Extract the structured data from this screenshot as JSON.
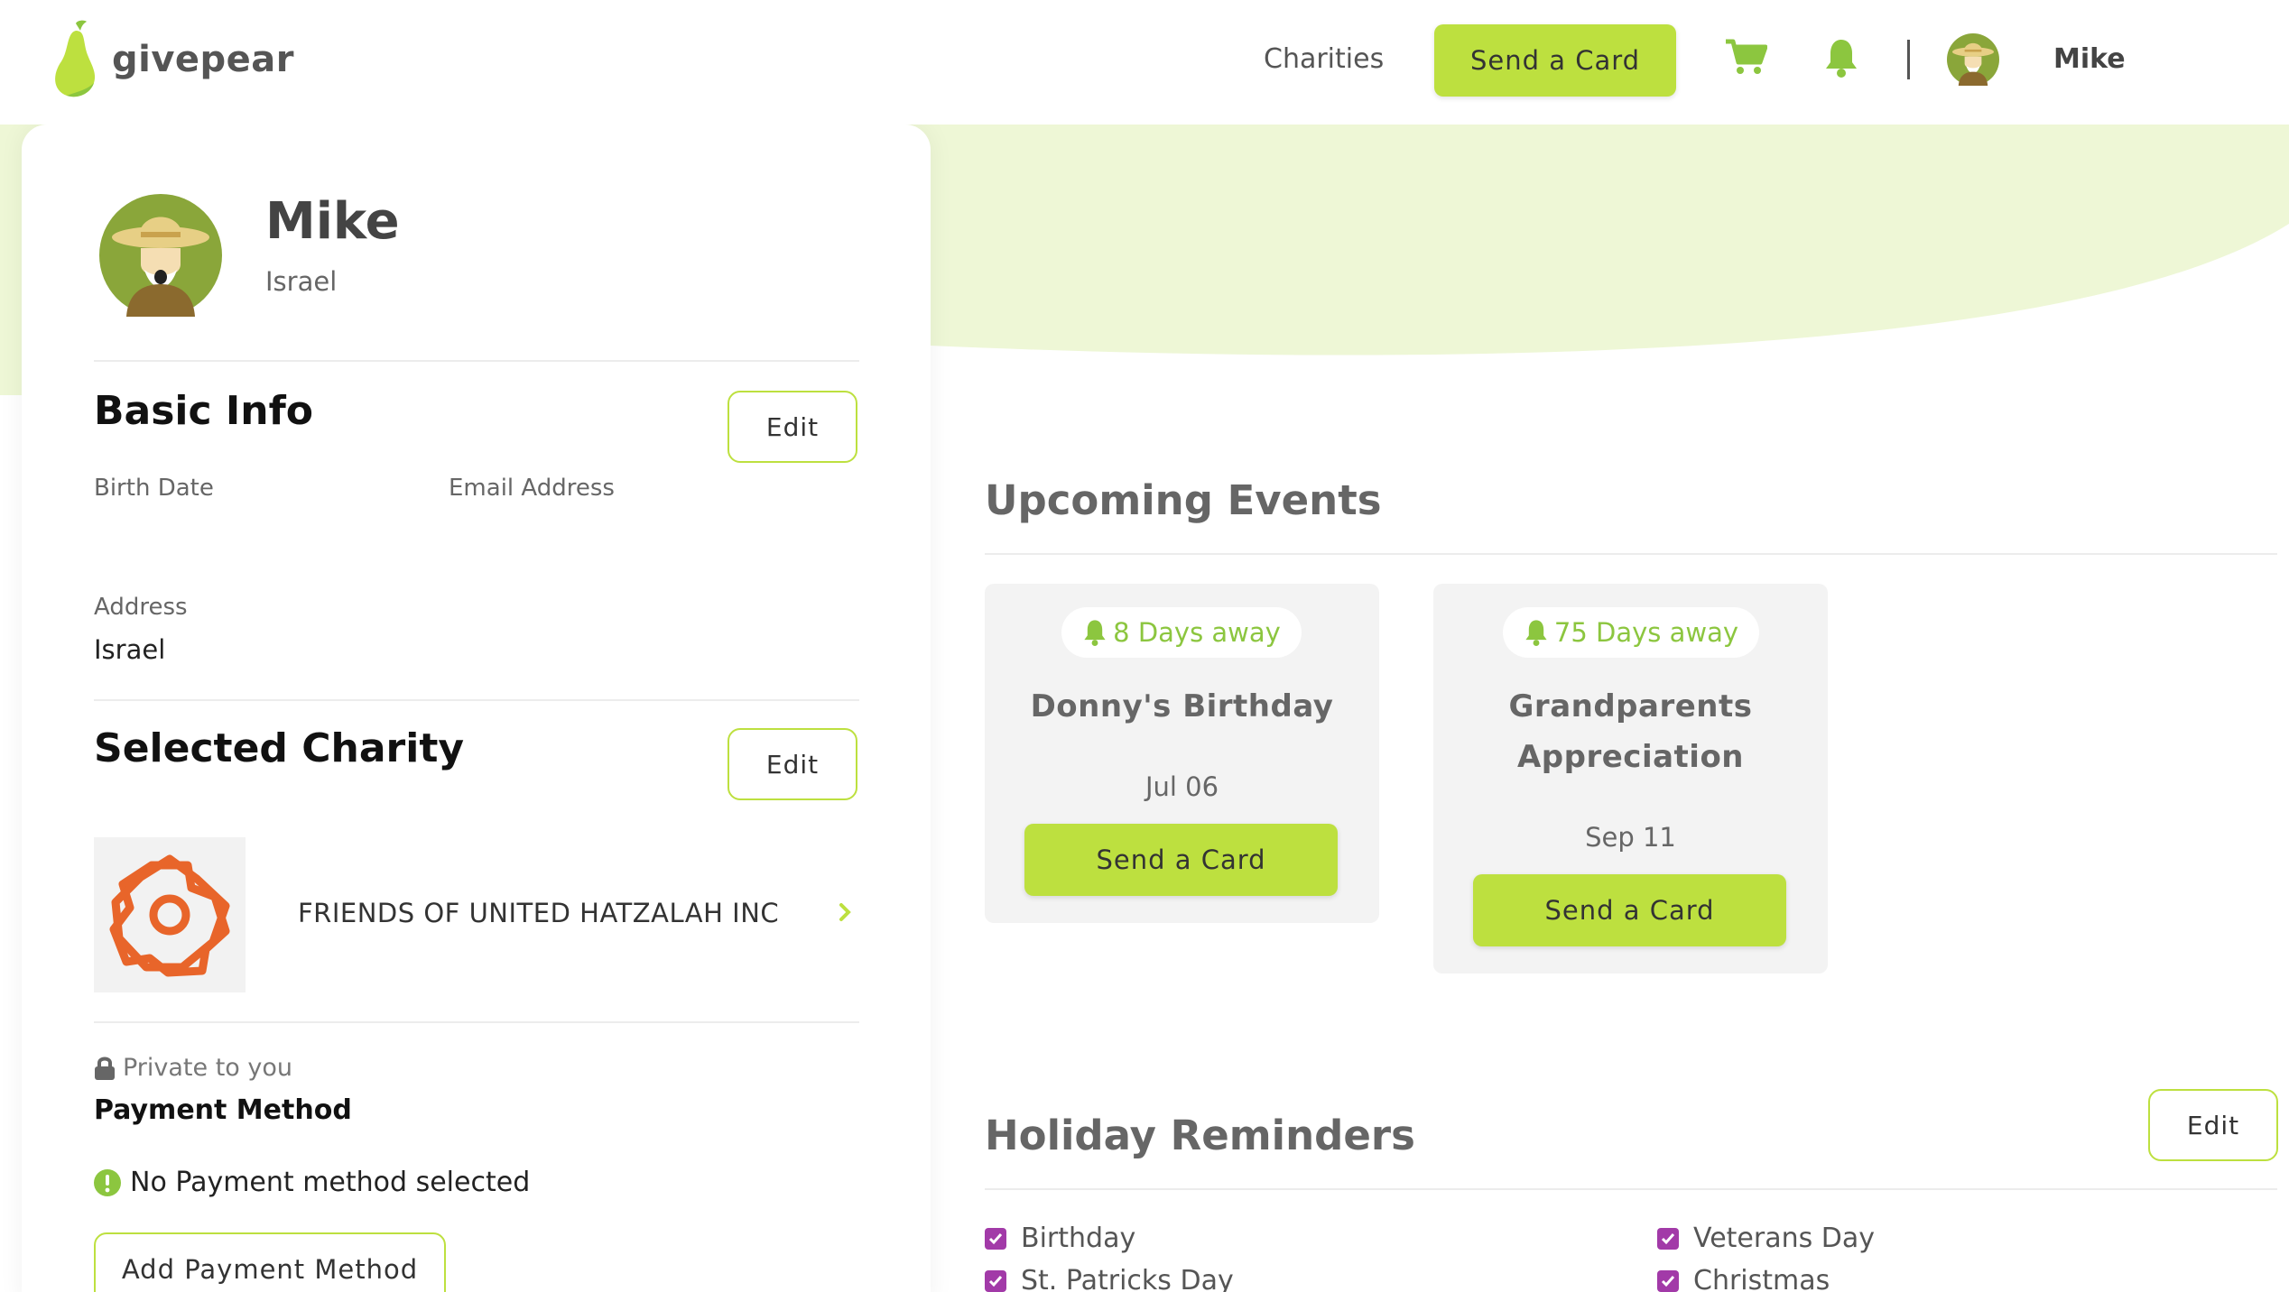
{
  "header": {
    "logo_text": "givepear",
    "nav_charities": "Charities",
    "send_card": "Send a Card",
    "user_name": "Mike"
  },
  "profile": {
    "name": "Mike",
    "location": "Israel",
    "basic_info": {
      "title": "Basic Info",
      "edit": "Edit",
      "birth_date_label": "Birth Date",
      "email_label": "Email Address",
      "address_label": "Address",
      "address_value": "Israel"
    },
    "selected_charity": {
      "title": "Selected Charity",
      "edit": "Edit",
      "name": "FRIENDS OF UNITED HATZALAH INC"
    },
    "payment": {
      "private_label": "Private to you",
      "title": "Payment Method",
      "status": "No Payment method selected",
      "add_button": "Add Payment Method"
    }
  },
  "upcoming": {
    "title": "Upcoming Events",
    "events": [
      {
        "days": "8 Days away",
        "name": "Donny's Birthday",
        "date": "Jul 06",
        "button": "Send a Card"
      },
      {
        "days": "75 Days away",
        "name_line1": "Grandparents",
        "name_line2": "Appreciation",
        "date": "Sep 11",
        "button": "Send a Card"
      }
    ]
  },
  "holidays": {
    "title": "Holiday Reminders",
    "edit": "Edit",
    "items": [
      "Birthday",
      "St. Patricks Day",
      "Veterans Day",
      "Christmas"
    ]
  },
  "colors": {
    "accent_green": "#bde03f",
    "pale_green": "#eef7d6",
    "pill_text_green": "#8cc63f",
    "checkbox_purple": "#a23aa8",
    "charity_orange": "#e8652a"
  }
}
